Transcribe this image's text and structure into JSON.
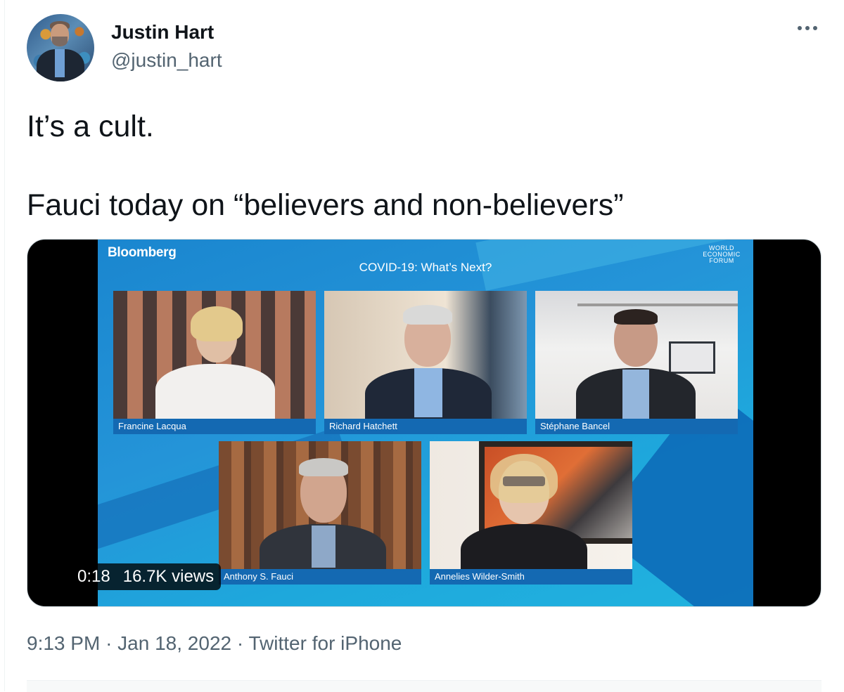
{
  "author": {
    "display_name": "Justin Hart",
    "handle": "@justin_hart"
  },
  "tweet": {
    "line1": "It’s a cult.",
    "line2": "Fauci today on “believers and non-believers”"
  },
  "video": {
    "network_logo": "Bloomberg",
    "org_logo": "WORLD ECONOMIC FORUM",
    "program_title": "COVID-19: What’s Next?",
    "participants": [
      "Francine Lacqua",
      "Richard Hatchett",
      "Stéphane Bancel",
      "Anthony S. Fauci",
      "Annelies Wilder-Smith"
    ],
    "duration": "0:18",
    "views": "16.7K views"
  },
  "meta": {
    "time": "9:13 PM",
    "date": "Jan 18, 2022",
    "client": "Twitter for iPhone",
    "separator": "·"
  },
  "icons": {
    "more": "more-horizontal-icon"
  },
  "colors": {
    "text": "#0f1419",
    "secondary": "#536471",
    "video_nameplate": "#1469b2",
    "video_background": "#2494d8"
  }
}
